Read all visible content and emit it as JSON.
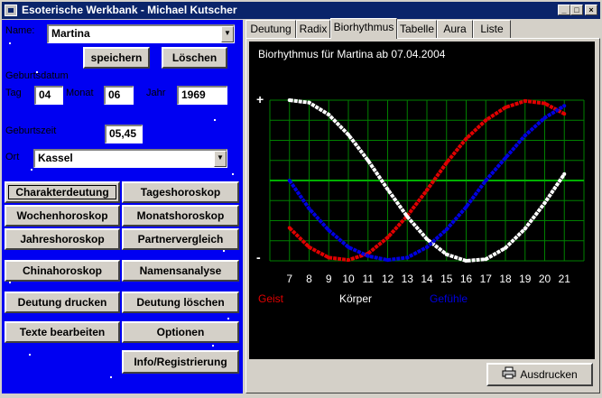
{
  "window": {
    "title": "Esoterische Werkbank - Michael Kutscher",
    "controls": {
      "minimize": "_",
      "maximize": "□",
      "close": "×"
    }
  },
  "form": {
    "name_label": "Name:",
    "name_value": "Martina",
    "save_button": "speichern",
    "delete_button": "Löschen",
    "birthdate_label": "Geburtsdatum",
    "day_label": "Tag",
    "day_value": "04",
    "month_label": "Monat",
    "month_value": "06",
    "year_label": "Jahr",
    "year_value": "1969",
    "birthtime_label": "Geburtszeit",
    "birthtime_value": "05,45",
    "place_label": "Ort",
    "place_value": "Kassel"
  },
  "buttons": {
    "charakterdeutung": "Charakterdeutung",
    "tageshoroskop": "Tageshoroskop",
    "wochenhoroskop": "Wochenhoroskop",
    "monatshoroskop": "Monatshoroskop",
    "jahreshoroskop": "Jahreshoroskop",
    "partnervergleich": "Partnervergleich",
    "chinahoroskop": "Chinahoroskop",
    "namensanalyse": "Namensanalyse",
    "deutung_drucken": "Deutung drucken",
    "deutung_loeschen": "Deutung löschen",
    "texte_bearbeiten": "Texte bearbeiten",
    "optionen": "Optionen",
    "info": "Info/Registrierung"
  },
  "tabs": [
    "Deutung",
    "Radix",
    "Biorhythmus",
    "Tabelle",
    "Aura",
    "Liste"
  ],
  "active_tab": "Biorhythmus",
  "print_button": "Ausdrucken",
  "colors": {
    "left_bg": "#0000f2",
    "grid": "#008000",
    "geist": "#e00000",
    "koerper": "#ffffff",
    "gefuehle": "#0000e0"
  },
  "chart_data": {
    "type": "line",
    "title": "Biorhythmus für Martina ab 07.04.2004",
    "y_top_label": "+",
    "y_bottom_label": "-",
    "x": [
      7,
      8,
      9,
      10,
      11,
      12,
      13,
      14,
      15,
      16,
      17,
      18,
      19,
      20,
      21
    ],
    "ylim": [
      -1,
      1
    ],
    "grid": true,
    "series": [
      {
        "name": "Geist",
        "color": "#e00000",
        "values": [
          -0.59,
          -0.83,
          -0.96,
          -0.99,
          -0.91,
          -0.71,
          -0.44,
          -0.12,
          0.22,
          0.52,
          0.75,
          0.91,
          0.99,
          0.96,
          0.83
        ]
      },
      {
        "name": "Körper",
        "color": "#ffffff",
        "values": [
          1.0,
          0.97,
          0.82,
          0.57,
          0.25,
          -0.11,
          -0.45,
          -0.73,
          -0.92,
          -1.0,
          -0.98,
          -0.84,
          -0.6,
          -0.28,
          0.08
        ]
      },
      {
        "name": "Gefühle",
        "color": "#0000e0",
        "values": [
          0.0,
          -0.35,
          -0.62,
          -0.83,
          -0.94,
          -0.99,
          -0.96,
          -0.83,
          -0.61,
          -0.33,
          0.0,
          0.28,
          0.56,
          0.78,
          0.93
        ]
      }
    ],
    "legend_placement": "bottom"
  }
}
